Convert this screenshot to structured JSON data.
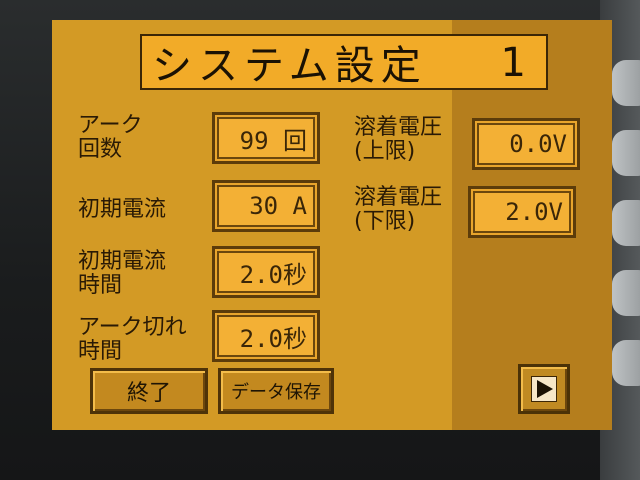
{
  "screen": {
    "title": "システム設定",
    "page_number": "1"
  },
  "settings": [
    {
      "label_line1": "アーク",
      "label_line2": "回数",
      "value": "99 回"
    },
    {
      "label_line1": "初期電流",
      "label_line2": "",
      "value": "30 A"
    },
    {
      "label_line1": "初期電流",
      "label_line2": "時間",
      "value": "2.0秒"
    },
    {
      "label_line1": "アーク切れ",
      "label_line2": "時間",
      "value": "2.0秒"
    }
  ],
  "voltage": [
    {
      "label_line1": "溶着電圧",
      "label_line2": "(上限)",
      "value": "0.0V"
    },
    {
      "label_line1": "溶着電圧",
      "label_line2": "(下限)",
      "value": "2.0V"
    }
  ],
  "buttons": {
    "end_label": "終了",
    "save_label": "データ保存",
    "next_icon": "play-arrow-icon"
  },
  "colors": {
    "screen_bg": "#d39a25",
    "field_bg": "#f3b035",
    "text": "#2a1a05"
  }
}
